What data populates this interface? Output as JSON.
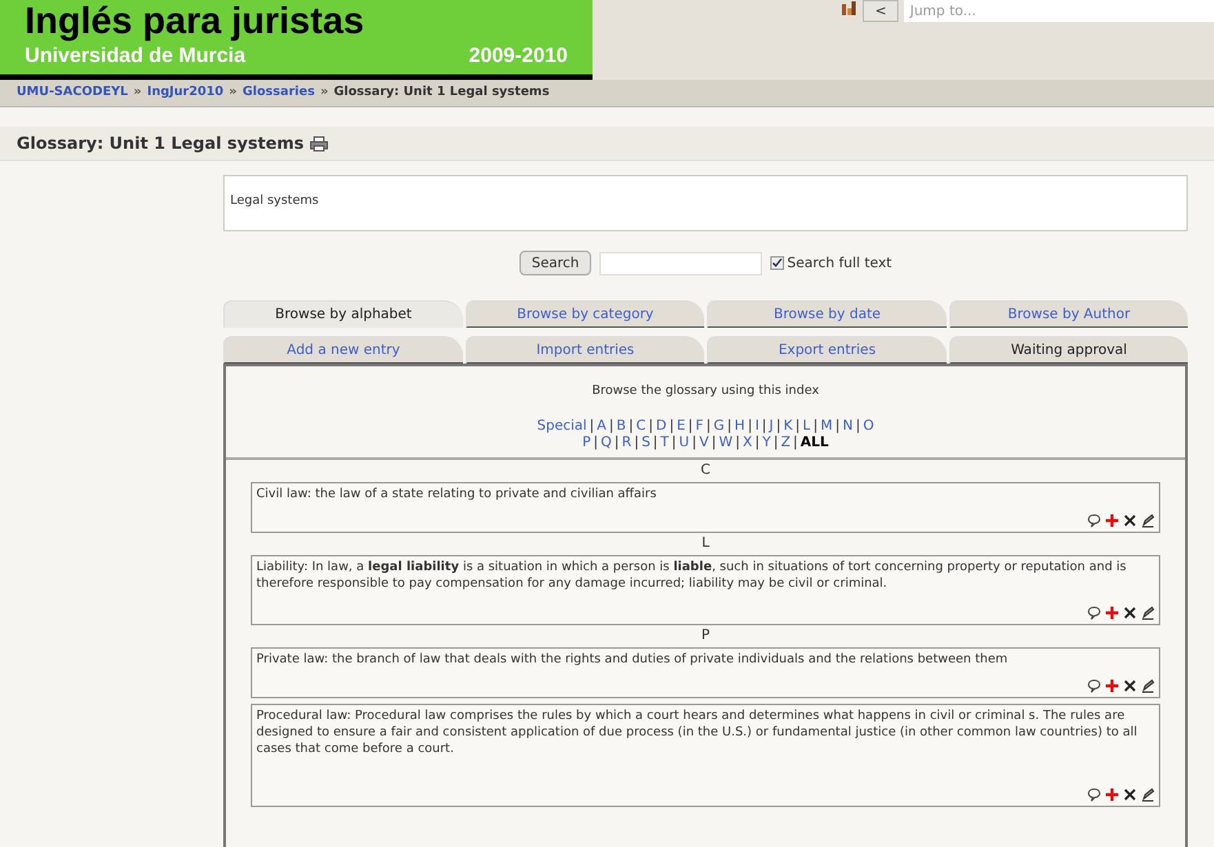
{
  "banner": {
    "title": "Inglés para juristas",
    "subtitle": "Universidad de Murcia",
    "years": "2009-2010"
  },
  "jump": {
    "button": "<",
    "placeholder": "Jump to..."
  },
  "breadcrumb": {
    "separator": "»",
    "items": [
      {
        "label": "UMU-SACODEYL",
        "link": true
      },
      {
        "label": "IngJur2010",
        "link": true
      },
      {
        "label": "Glossaries",
        "link": true
      },
      {
        "label": "Glossary: Unit 1 Legal systems",
        "link": false
      }
    ]
  },
  "page_title": "Glossary: Unit 1 Legal systems",
  "description": "Legal systems",
  "search": {
    "button": "Search",
    "full_text_label": "Search full text",
    "full_text_checked": true
  },
  "tab_rows": [
    [
      {
        "label": "Browse by alphabet",
        "selected": true,
        "link": false
      },
      {
        "label": "Browse by category",
        "selected": false,
        "link": true
      },
      {
        "label": "Browse by date",
        "selected": false,
        "link": true
      },
      {
        "label": "Browse by Author",
        "selected": false,
        "link": true
      }
    ],
    [
      {
        "label": "Add a new entry",
        "selected": false,
        "link": true
      },
      {
        "label": "Import entries",
        "selected": false,
        "link": true
      },
      {
        "label": "Export entries",
        "selected": false,
        "link": true
      },
      {
        "label": "Waiting approval",
        "selected": false,
        "link": false
      }
    ]
  ],
  "index": {
    "heading": "Browse the glossary using this index",
    "separator": "|",
    "letters": [
      {
        "label": "Special",
        "selected": false
      },
      {
        "label": "A",
        "selected": false
      },
      {
        "label": "B",
        "selected": false
      },
      {
        "label": "C",
        "selected": false
      },
      {
        "label": "D",
        "selected": false
      },
      {
        "label": "E",
        "selected": false
      },
      {
        "label": "F",
        "selected": false
      },
      {
        "label": "G",
        "selected": false
      },
      {
        "label": "H",
        "selected": false
      },
      {
        "label": "I",
        "selected": false
      },
      {
        "label": "J",
        "selected": false
      },
      {
        "label": "K",
        "selected": false
      },
      {
        "label": "L",
        "selected": false
      },
      {
        "label": "M",
        "selected": false
      },
      {
        "label": "N",
        "selected": false
      },
      {
        "label": "O",
        "selected": false
      },
      {
        "label": "P",
        "selected": false,
        "line_start": true
      },
      {
        "label": "Q",
        "selected": false
      },
      {
        "label": "R",
        "selected": false
      },
      {
        "label": "S",
        "selected": false
      },
      {
        "label": "T",
        "selected": false
      },
      {
        "label": "U",
        "selected": false
      },
      {
        "label": "V",
        "selected": false
      },
      {
        "label": "W",
        "selected": false
      },
      {
        "label": "X",
        "selected": false
      },
      {
        "label": "Y",
        "selected": false
      },
      {
        "label": "Z",
        "selected": false
      },
      {
        "label": "ALL",
        "selected": true
      }
    ]
  },
  "entries": [
    {
      "letter": "C",
      "text": "Civil law: the law of a state relating to private and civilian affairs"
    },
    {
      "letter": "L",
      "text": "Liability: In law, a **legal liability** is a situation in which a person is **liable**, such in situations of tort concerning property or reputation and is therefore responsible to pay compensation for any damage incurred; liability may be civil or criminal."
    },
    {
      "letter": "P",
      "text": "Private law: the branch of law that deals with the rights and duties of private individuals and the relations between them"
    },
    {
      "text": "Procedural law: Procedural law comprises the rules by which a court hears and determines what happens in civil or criminal s. The rules are designed to ensure a fair and consistent application of due process (in the U.S.) or fundamental justice (in other common law countries) to all cases that come before a court."
    }
  ]
}
